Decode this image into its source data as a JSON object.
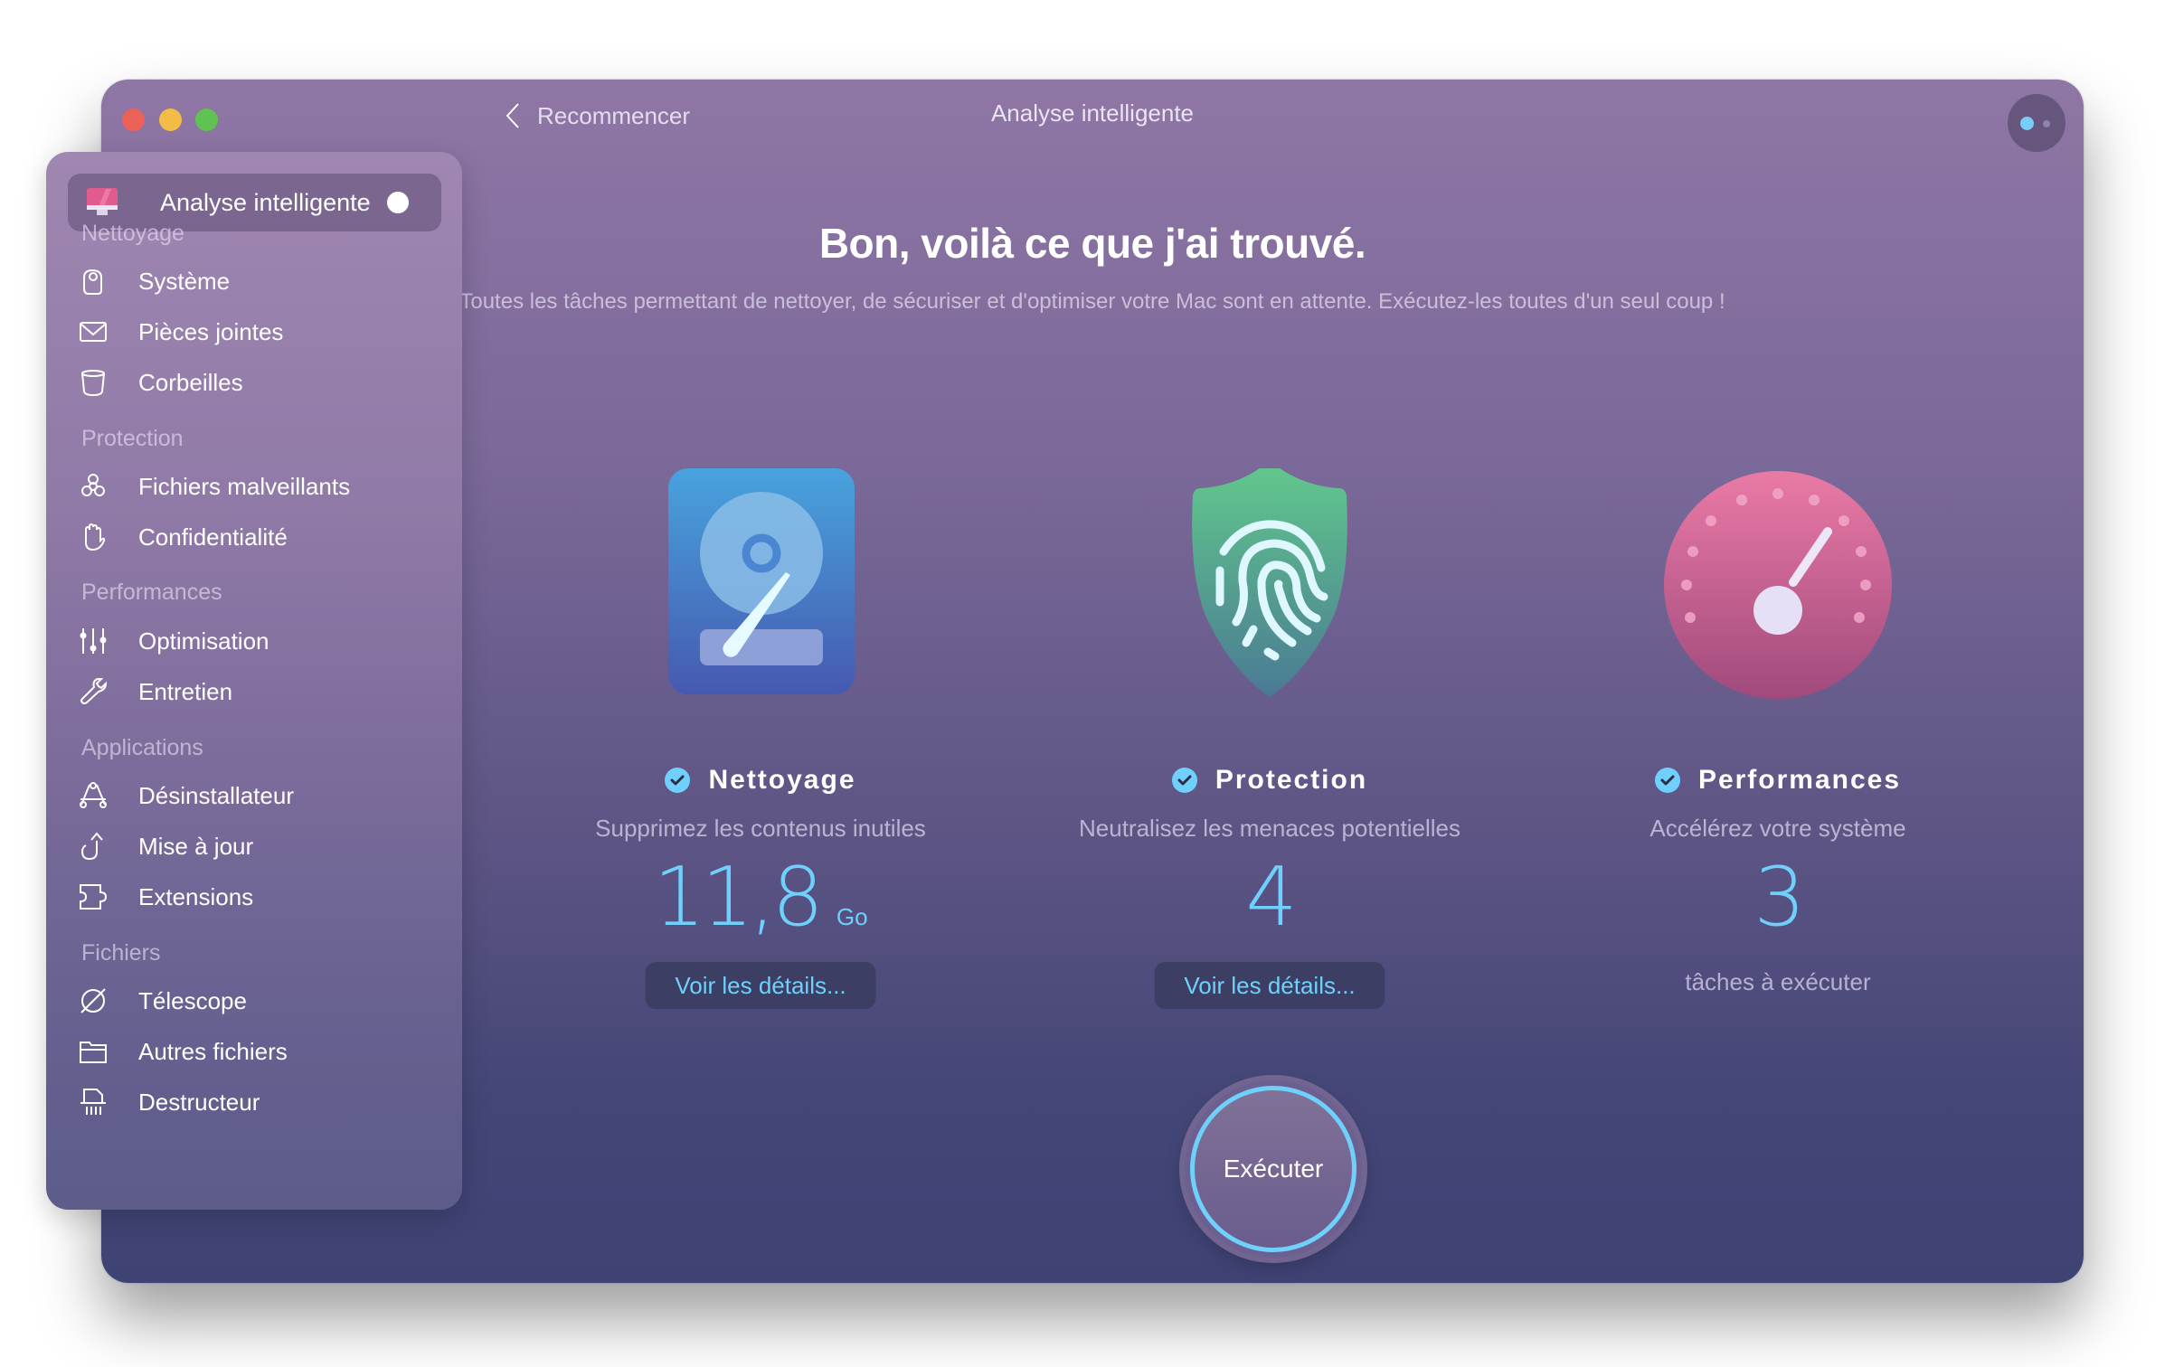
{
  "window": {
    "title": "Analyse intelligente",
    "back_label": "Recommencer",
    "traffic_lights": [
      "close",
      "minimize",
      "maximize"
    ]
  },
  "sidebar": {
    "active": {
      "label": "Analyse intelligente",
      "icon": "imac-icon"
    },
    "sections": [
      {
        "label": "Nettoyage",
        "items": [
          {
            "label": "Système",
            "icon": "system-junk-icon"
          },
          {
            "label": "Pièces jointes",
            "icon": "mail-icon"
          },
          {
            "label": "Corbeilles",
            "icon": "trash-bin-icon"
          }
        ]
      },
      {
        "label": "Protection",
        "items": [
          {
            "label": "Fichiers malveillants",
            "icon": "biohazard-icon"
          },
          {
            "label": "Confidentialité",
            "icon": "hand-icon"
          }
        ]
      },
      {
        "label": "Performances",
        "items": [
          {
            "label": "Optimisation",
            "icon": "sliders-icon"
          },
          {
            "label": "Entretien",
            "icon": "wrench-icon"
          }
        ]
      },
      {
        "label": "Applications",
        "items": [
          {
            "label": "Désinstallateur",
            "icon": "app-uninstaller-icon"
          },
          {
            "label": "Mise à jour",
            "icon": "update-arrow-icon"
          },
          {
            "label": "Extensions",
            "icon": "puzzle-icon"
          }
        ]
      },
      {
        "label": "Fichiers",
        "items": [
          {
            "label": "Télescope",
            "icon": "planet-icon"
          },
          {
            "label": "Autres fichiers",
            "icon": "folder-icon"
          },
          {
            "label": "Destructeur",
            "icon": "shredder-icon"
          }
        ]
      }
    ]
  },
  "main": {
    "heading": "Bon, voilà ce que j'ai trouvé.",
    "subtitle": "Toutes les tâches permettant de nettoyer, de sécuriser et d'optimiser votre Mac sont en attente. Exécutez-les toutes d'un seul coup !",
    "cards": [
      {
        "title": "Nettoyage",
        "description": "Supprimez les contenus inutiles",
        "value": "11,8",
        "unit": "Go",
        "button": "Voir les détails...",
        "checked": true,
        "icon": "hard-disk-icon"
      },
      {
        "title": "Protection",
        "description": "Neutralisez les menaces potentielles",
        "value": "4",
        "button": "Voir les détails...",
        "checked": true,
        "icon": "fingerprint-shield-icon"
      },
      {
        "title": "Performances",
        "description": "Accélérez votre système",
        "value": "3",
        "caption": "tâches à exécuter",
        "checked": true,
        "icon": "speed-gauge-icon"
      }
    ],
    "run_button": "Exécuter"
  },
  "colors": {
    "accent": "#6fd0fb",
    "window_top": "#8f76a5",
    "window_bottom": "#3e4374",
    "close": "#ec6158",
    "minimize": "#f3bc47",
    "maximize": "#5fc354"
  }
}
